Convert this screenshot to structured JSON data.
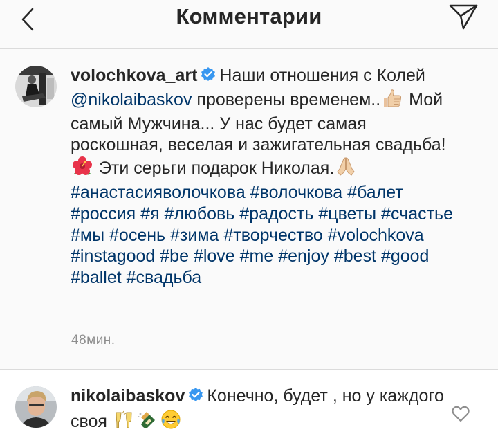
{
  "header": {
    "title": "Комментарии"
  },
  "post": {
    "username": "volochkova_art",
    "text_1": "Наши отношения с Колей ",
    "mention": "@nikolaibaskov",
    "text_2": " проверены временем..",
    "text_3": " Мой самый Мужчина... У нас будет самая роскошная, веселая и зажигательная свадьба!",
    "text_4": " Эти серьги подарок Николая.",
    "hashtags": "#анастасияволочкова #волочкова #балет #россия #я #любовь #радость #цветы #счастье #мы #осень #зима #творчество #volochkova #instagood #be #love #me #enjoy #best #good #ballet #свадьба",
    "timestamp": "48мин."
  },
  "reply": {
    "username": "nikolaibaskov",
    "text": "Конечно, будет , но у каждого своя"
  },
  "icons": {
    "back": "chevron-left-icon",
    "send": "paper-plane-icon",
    "verified": "verified-badge-icon",
    "like": "heart-outline-icon",
    "thumbs_up": "thumbs-up-emoji",
    "hibiscus": "hibiscus-emoji",
    "folded_hands": "folded-hands-emoji",
    "clinking_glasses": "clinking-glasses-emoji",
    "champagne": "champagne-bottle-emoji",
    "laughing": "tears-of-joy-emoji"
  },
  "colors": {
    "link": "#003569",
    "verified": "#3897f0",
    "meta": "#8e8e8e",
    "divider": "#dbdbdb"
  }
}
